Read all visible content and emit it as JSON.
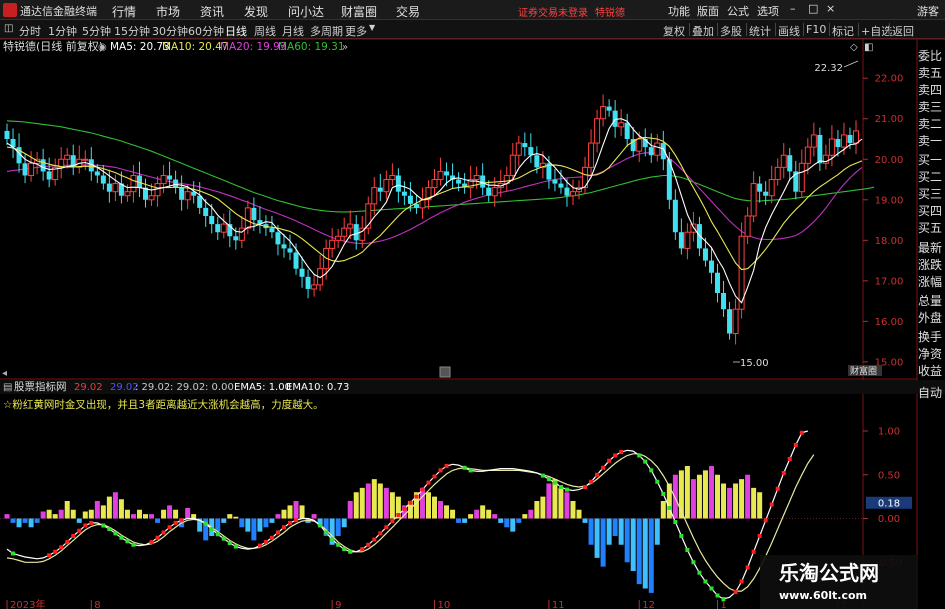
{
  "app": {
    "title": "通达信金融终端",
    "menus": [
      "行情",
      "市场",
      "资讯",
      "发现",
      "问小达",
      "财富圈",
      "交易"
    ],
    "notice": "证券交易未登录",
    "stock_short": "特锐德",
    "right_menus": [
      "功能",
      "版面",
      "公式",
      "选项"
    ],
    "guest": "游客"
  },
  "toolbar": {
    "periods": [
      "分时",
      "1分钟",
      "5分钟",
      "15分钟",
      "30分钟",
      "60分钟",
      "日线",
      "周线",
      "月线",
      "多周期",
      "更多"
    ],
    "active": "日线",
    "right": [
      "复权",
      "叠加",
      "多股",
      "统计",
      "画线",
      "F10",
      "标记",
      "+自选",
      "返回"
    ]
  },
  "main": {
    "title": "特锐德(日线 前复权)",
    "ma": [
      {
        "label": "MA5: 20.73",
        "color": "#ffffff"
      },
      {
        "label": "MA10: 20.47",
        "color": "#e8e850"
      },
      {
        "label": "MA20: 19.93",
        "color": "#e040e0"
      },
      {
        "label": "MA60: 19.31",
        "color": "#30c030"
      }
    ],
    "hi_label": "22.32",
    "lo_label": "15.00",
    "tag": "财富圈"
  },
  "right_panel": [
    "委比",
    "卖五",
    "卖四",
    "卖三",
    "卖二",
    "卖一",
    "买一",
    "买二",
    "买三",
    "买四",
    "买五",
    "最新",
    "涨跌",
    "涨幅",
    "总量",
    "外盘",
    "换手",
    "净资",
    "收益"
  ],
  "sub": {
    "tab": "股票指标网",
    "vals": [
      {
        "label": "29.02",
        "color": "#e04040"
      },
      {
        "label": "29.02",
        "color": "#5050ff"
      },
      {
        "label": ": 29.02",
        "color": "#c8c8c8"
      },
      {
        "label": ": 29.02",
        "color": "#c8c8c8"
      },
      {
        "label": ": 0.00",
        "color": "#c8c8c8"
      },
      {
        "label": "EMA5: 1.00",
        "color": "#ffffff"
      },
      {
        "label": "EMA10: 0.73",
        "color": "#ffffff"
      }
    ],
    "note": "☆粉红黄网时金叉出现，并且3者距离越近大涨机会越高，力度越大。",
    "auto": "自动",
    "cur": "0.18"
  },
  "axis": {
    "dates": [
      "2023年",
      "8",
      "9",
      "10",
      "11",
      "12",
      "1",
      "2"
    ]
  },
  "watermark": {
    "title": "乐淘公式网",
    "url": "www.60lt.com"
  },
  "chart_data": [
    {
      "type": "candlestick",
      "title": "特锐德(日线 前复权)",
      "ylim": [
        14.8,
        22.4
      ],
      "y_ticks": [
        15,
        16,
        17,
        18,
        19,
        20,
        21,
        22
      ],
      "x_ticks": [
        "2023年",
        "8",
        "9",
        "10",
        "11",
        "12",
        "1",
        "2"
      ],
      "close": [
        20.5,
        20.3,
        19.9,
        19.6,
        19.9,
        20,
        19.7,
        19.5,
        19.8,
        20,
        20.1,
        19.8,
        20,
        20,
        19.7,
        19.6,
        19.4,
        19.2,
        19.4,
        19.1,
        19.2,
        19.6,
        19.3,
        19,
        19.1,
        19.4,
        19.6,
        19.5,
        19.3,
        19,
        19.2,
        19.1,
        18.8,
        18.6,
        18.4,
        18.2,
        18.4,
        18.1,
        18,
        18.3,
        18.8,
        18.5,
        18.4,
        18.3,
        18.2,
        17.9,
        17.8,
        17.7,
        17.3,
        17.1,
        16.8,
        16.9,
        17.3,
        17.8,
        18,
        18.1,
        18.3,
        18.4,
        18,
        18.3,
        18.9,
        19.3,
        19.2,
        19.5,
        19.6,
        19.2,
        19.1,
        18.9,
        18.8,
        19,
        19.3,
        19.5,
        19.7,
        19.6,
        19.5,
        19.4,
        19.3,
        19.5,
        19.6,
        19.3,
        19.1,
        19.3,
        19.4,
        19.6,
        20.1,
        20.4,
        20.3,
        20.1,
        19.8,
        19.9,
        19.5,
        19.4,
        19.3,
        19.1,
        19.2,
        19.3,
        19.8,
        20.4,
        21,
        21.3,
        21.2,
        20.8,
        20.9,
        20.5,
        20.2,
        20.5,
        20.3,
        20.1,
        20.4,
        20,
        19,
        18.2,
        17.8,
        18.2,
        18.4,
        17.8,
        17.5,
        17.2,
        16.7,
        16.3,
        15.7,
        16.3,
        18.1,
        18.6,
        19.4,
        19.2,
        19.1,
        19.5,
        19.8,
        20.1,
        19.7,
        19.2,
        19.9,
        20.3,
        20.6,
        19.9,
        20.1,
        20.5,
        20.3,
        20.6,
        20.4,
        20.7
      ],
      "ma5": [
        20.4,
        20.3,
        20.15,
        20,
        19.92,
        19.88,
        19.8,
        19.75,
        19.76,
        19.78,
        19.82,
        19.84,
        19.9,
        19.92,
        19.87,
        19.8,
        19.7,
        19.59,
        19.48,
        19.38,
        19.3,
        19.31,
        19.3,
        19.27,
        19.24,
        19.27,
        19.3,
        19.34,
        19.38,
        19.36,
        19.32,
        19.22,
        19.12,
        18.95,
        18.82,
        18.62,
        18.48,
        18.35,
        18.22,
        18.2,
        18.32,
        18.34,
        18.4,
        18.46,
        18.44,
        18.26,
        18.12,
        17.98,
        17.78,
        17.56,
        17.34,
        17.16,
        17.08,
        17.18,
        17.36,
        17.62,
        17.9,
        18.12,
        18.16,
        18.22,
        18.38,
        18.58,
        18.74,
        18.94,
        19.3,
        19.36,
        19.32,
        19.26,
        19.12,
        19,
        19.02,
        19.1,
        19.24,
        19.42,
        19.52,
        19.54,
        19.5,
        19.46,
        19.46,
        19.42,
        19.36,
        19.36,
        19.34,
        19.4,
        19.5,
        19.78,
        19.96,
        20.1,
        20.14,
        20.1,
        19.94,
        19.8,
        19.62,
        19.44,
        19.3,
        19.26,
        19.32,
        19.56,
        19.94,
        20.36,
        20.76,
        20.98,
        21,
        20.94,
        20.74,
        20.58,
        20.48,
        20.34,
        20.3,
        20.26,
        19.96,
        19.56,
        19.1,
        18.64,
        18.32,
        18.12,
        17.98,
        17.82,
        17.54,
        17.3,
        16.94,
        16.62,
        16.46,
        16.84,
        17.26,
        17.9,
        18.32,
        18.64,
        18.92,
        19.2,
        19.5,
        19.64,
        19.68,
        19.74,
        19.86,
        19.96,
        19.94,
        20.02,
        20.14,
        20.24,
        20.36,
        20.38,
        20.5
      ],
      "ma10": [
        20.3,
        20.28,
        20.22,
        20.14,
        20.05,
        19.96,
        19.92,
        19.88,
        19.84,
        19.82,
        19.81,
        19.81,
        19.82,
        19.83,
        19.82,
        19.81,
        19.77,
        19.72,
        19.67,
        19.6,
        19.54,
        19.47,
        19.43,
        19.38,
        19.33,
        19.29,
        19.3,
        19.3,
        19.31,
        19.3,
        19.29,
        19.26,
        19.22,
        19.16,
        19.1,
        19.02,
        18.9,
        18.78,
        18.66,
        18.56,
        18.48,
        18.41,
        18.38,
        18.34,
        18.32,
        18.3,
        18.26,
        18.22,
        18.14,
        18.04,
        17.92,
        17.8,
        17.68,
        17.56,
        17.5,
        17.48,
        17.5,
        17.56,
        17.62,
        17.71,
        17.86,
        18,
        18.12,
        18.28,
        18.44,
        18.6,
        18.74,
        18.84,
        18.92,
        19,
        19.05,
        19.1,
        19.16,
        19.22,
        19.28,
        19.3,
        19.32,
        19.34,
        19.37,
        19.41,
        19.43,
        19.44,
        19.45,
        19.46,
        19.49,
        19.54,
        19.62,
        19.7,
        19.76,
        19.82,
        19.85,
        19.86,
        19.84,
        19.8,
        19.74,
        19.68,
        19.62,
        19.6,
        19.62,
        19.68,
        19.8,
        19.98,
        20.16,
        20.34,
        20.44,
        20.52,
        20.54,
        20.52,
        20.5,
        20.44,
        20.32,
        20.1,
        19.84,
        19.56,
        19.3,
        19.04,
        18.76,
        18.46,
        18.22,
        17.96,
        17.7,
        17.44,
        17.28,
        17.3,
        17.44,
        17.6,
        17.78,
        17.98,
        18.2,
        18.42,
        18.6,
        18.76,
        18.9,
        19.06,
        19.2,
        19.32,
        19.42,
        19.52,
        19.62,
        19.74,
        19.84,
        19.9,
        19.96
      ],
      "ma20": [
        19.7,
        19.72,
        19.74,
        19.76,
        19.78,
        19.8,
        19.82,
        19.83,
        19.84,
        19.85,
        19.85,
        19.86,
        19.86,
        19.86,
        19.86,
        19.85,
        19.84,
        19.82,
        19.8,
        19.76,
        19.72,
        19.68,
        19.64,
        19.6,
        19.56,
        19.52,
        19.48,
        19.45,
        19.42,
        19.4,
        19.38,
        19.35,
        19.32,
        19.28,
        19.24,
        19.2,
        19.15,
        19.1,
        19.05,
        18.99,
        18.94,
        18.88,
        18.82,
        18.76,
        18.71,
        18.66,
        18.6,
        18.54,
        18.48,
        18.41,
        18.34,
        18.27,
        18.2,
        18.13,
        18.07,
        18.02,
        17.98,
        17.95,
        17.93,
        17.92,
        17.93,
        17.95,
        17.98,
        18.02,
        18.07,
        18.13,
        18.2,
        18.27,
        18.35,
        18.43,
        18.52,
        18.6,
        18.68,
        18.75,
        18.82,
        18.88,
        18.94,
        18.99,
        19.04,
        19.08,
        19.12,
        19.15,
        19.18,
        19.21,
        19.24,
        19.28,
        19.32,
        19.36,
        19.4,
        19.44,
        19.47,
        19.5,
        19.52,
        19.54,
        19.55,
        19.56,
        19.57,
        19.6,
        19.64,
        19.7,
        19.78,
        19.86,
        19.94,
        20.02,
        20.08,
        20.13,
        20.16,
        20.16,
        20.14,
        20.1,
        20.02,
        19.9,
        19.76,
        19.6,
        19.44,
        19.28,
        19.12,
        18.96,
        18.8,
        18.64,
        18.48,
        18.34,
        18.22,
        18.13,
        18.07,
        18.03,
        18.02,
        18.02,
        18.03,
        18.05,
        18.08,
        18.12,
        18.2,
        18.32,
        18.46,
        18.62,
        18.8,
        19,
        19.2,
        19.38,
        19.54,
        19.68,
        19.8
      ],
      "ma60": [
        20.95,
        20.94,
        20.93,
        20.92,
        20.9,
        20.88,
        20.86,
        20.84,
        20.82,
        20.8,
        20.77,
        20.74,
        20.71,
        20.68,
        20.65,
        20.61,
        20.57,
        20.53,
        20.49,
        20.45,
        20.4,
        20.35,
        20.3,
        20.25,
        20.2,
        20.14,
        20.08,
        20.02,
        19.96,
        19.9,
        19.84,
        19.78,
        19.72,
        19.66,
        19.6,
        19.54,
        19.48,
        19.42,
        19.36,
        19.3,
        19.24,
        19.18,
        19.13,
        19.08,
        19.03,
        18.98,
        18.94,
        18.9,
        18.86,
        18.82,
        18.79,
        18.76,
        18.74,
        18.72,
        18.71,
        18.7,
        18.7,
        18.7,
        18.71,
        18.72,
        18.73,
        18.74,
        18.75,
        18.76,
        18.77,
        18.78,
        18.79,
        18.8,
        18.81,
        18.82,
        18.83,
        18.84,
        18.85,
        18.86,
        18.87,
        18.88,
        18.89,
        18.9,
        18.91,
        18.92,
        18.93,
        18.94,
        18.95,
        18.96,
        18.97,
        18.98,
        18.99,
        19,
        19.01,
        19.02,
        19.03,
        19.04,
        19.06,
        19.08,
        19.1,
        19.12,
        19.15,
        19.18,
        19.22,
        19.26,
        19.3,
        19.34,
        19.38,
        19.42,
        19.46,
        19.5,
        19.53,
        19.56,
        19.58,
        19.6,
        19.6,
        19.58,
        19.55,
        19.5,
        19.44,
        19.38,
        19.32,
        19.26,
        19.2,
        19.14,
        19.08,
        19.03,
        19,
        18.98,
        18.97,
        18.97,
        18.98,
        18.99,
        19,
        19.01,
        19.02,
        19.04,
        19.06,
        19.08,
        19.1,
        19.12,
        19.14,
        19.16,
        19.18,
        19.2,
        19.22,
        19.24,
        19.26,
        19.28,
        19.31
      ]
    },
    {
      "type": "bar",
      "title": "股票指标网",
      "ylim": [
        -1.0,
        1.4
      ],
      "y_ticks": [
        1.0,
        0.5,
        0,
        -0.5
      ],
      "current": 0.18,
      "values": [
        0.05,
        -0.05,
        -0.1,
        -0.05,
        -0.1,
        -0.05,
        0.08,
        0.1,
        0.05,
        0.1,
        0.2,
        0.1,
        -0.05,
        0.08,
        0.1,
        0.2,
        0.15,
        0.25,
        0.3,
        0.22,
        0.1,
        0.05,
        0.1,
        0.05,
        0.05,
        -0.05,
        0.1,
        0.15,
        0.1,
        -0.1,
        0.12,
        0.05,
        -0.15,
        -0.25,
        -0.2,
        -0.15,
        -0.05,
        0.05,
        0.02,
        -0.1,
        -0.15,
        -0.25,
        -0.15,
        -0.1,
        -0.05,
        0.05,
        0.1,
        0.15,
        0.2,
        0.15,
        -0.05,
        0.05,
        -0.08,
        -0.2,
        -0.3,
        -0.2,
        -0.1,
        0.2,
        0.3,
        0.35,
        0.4,
        0.45,
        0.4,
        0.35,
        0.3,
        0.25,
        0.15,
        0.2,
        0.3,
        0.35,
        0.3,
        0.25,
        0.2,
        0.15,
        0.1,
        -0.05,
        -0.05,
        0.05,
        0.1,
        0.15,
        0.1,
        0.05,
        -0.05,
        -0.1,
        -0.15,
        -0.05,
        0.05,
        0.1,
        0.2,
        0.25,
        0.4,
        0.45,
        0.35,
        0.3,
        0.2,
        0.1,
        -0.05,
        -0.3,
        -0.45,
        -0.55,
        -0.3,
        -0.2,
        -0.3,
        -0.5,
        -0.6,
        -0.75,
        -0.8,
        -0.85,
        -0.3,
        0.2,
        0.4,
        0.5,
        0.55,
        0.6,
        0.45,
        0.5,
        0.55,
        0.6,
        0.5,
        0.4,
        0.35,
        0.4,
        0.45,
        0.5,
        0.35,
        0.3
      ],
      "ema5": [
        -0.35,
        -0.4,
        -0.42,
        -0.44,
        -0.45,
        -0.46,
        -0.45,
        -0.42,
        -0.38,
        -0.33,
        -0.27,
        -0.2,
        -0.14,
        -0.08,
        -0.05,
        -0.05,
        -0.08,
        -0.12,
        -0.17,
        -0.22,
        -0.26,
        -0.3,
        -0.31,
        -0.3,
        -0.27,
        -0.22,
        -0.16,
        -0.1,
        -0.05,
        -0.02,
        0.0,
        0.0,
        -0.02,
        -0.06,
        -0.12,
        -0.18,
        -0.23,
        -0.28,
        -0.32,
        -0.34,
        -0.35,
        -0.34,
        -0.31,
        -0.27,
        -0.22,
        -0.16,
        -0.1,
        -0.05,
        -0.02,
        0.0,
        0.0,
        -0.02,
        -0.08,
        -0.16,
        -0.24,
        -0.3,
        -0.35,
        -0.38,
        -0.38,
        -0.35,
        -0.3,
        -0.24,
        -0.17,
        -0.1,
        -0.03,
        0.04,
        0.11,
        0.18,
        0.25,
        0.33,
        0.41,
        0.48,
        0.55,
        0.6,
        0.62,
        0.61,
        0.58,
        0.55,
        0.54,
        0.54,
        0.55,
        0.56,
        0.57,
        0.57,
        0.57,
        0.56,
        0.55,
        0.54,
        0.52,
        0.49,
        0.45,
        0.41,
        0.36,
        0.33,
        0.32,
        0.33,
        0.36,
        0.42,
        0.5,
        0.58,
        0.66,
        0.72,
        0.76,
        0.78,
        0.77,
        0.72,
        0.65,
        0.55,
        0.42,
        0.28,
        0.12,
        -0.04,
        -0.2,
        -0.36,
        -0.5,
        -0.62,
        -0.72,
        -0.8,
        -0.88,
        -0.92,
        -0.9,
        -0.84,
        -0.72,
        -0.56,
        -0.38,
        -0.2,
        -0.02,
        0.16,
        0.34,
        0.52,
        0.68,
        0.84,
        0.98,
        1.0
      ],
      "ema10": [
        -0.45,
        -0.46,
        -0.48,
        -0.5,
        -0.5,
        -0.5,
        -0.49,
        -0.46,
        -0.42,
        -0.37,
        -0.31,
        -0.25,
        -0.19,
        -0.13,
        -0.09,
        -0.07,
        -0.07,
        -0.1,
        -0.14,
        -0.19,
        -0.23,
        -0.27,
        -0.29,
        -0.3,
        -0.29,
        -0.26,
        -0.21,
        -0.15,
        -0.1,
        -0.05,
        -0.02,
        -0.01,
        -0.02,
        -0.05,
        -0.1,
        -0.15,
        -0.2,
        -0.25,
        -0.29,
        -0.32,
        -0.34,
        -0.34,
        -0.33,
        -0.3,
        -0.26,
        -0.21,
        -0.16,
        -0.1,
        -0.06,
        -0.03,
        -0.02,
        -0.03,
        -0.07,
        -0.13,
        -0.2,
        -0.27,
        -0.32,
        -0.36,
        -0.38,
        -0.38,
        -0.35,
        -0.3,
        -0.24,
        -0.17,
        -0.1,
        -0.03,
        0.04,
        0.11,
        0.18,
        0.25,
        0.32,
        0.39,
        0.45,
        0.51,
        0.55,
        0.57,
        0.58,
        0.57,
        0.56,
        0.55,
        0.55,
        0.55,
        0.55,
        0.55,
        0.55,
        0.55,
        0.54,
        0.53,
        0.52,
        0.5,
        0.48,
        0.45,
        0.42,
        0.39,
        0.37,
        0.36,
        0.37,
        0.4,
        0.45,
        0.51,
        0.57,
        0.63,
        0.68,
        0.72,
        0.74,
        0.74,
        0.71,
        0.66,
        0.59,
        0.49,
        0.37,
        0.23,
        0.08,
        -0.07,
        -0.22,
        -0.36,
        -0.48,
        -0.58,
        -0.67,
        -0.74,
        -0.8,
        -0.83,
        -0.83,
        -0.78,
        -0.69,
        -0.57,
        -0.43,
        -0.28,
        -0.12,
        0.04,
        0.2,
        0.36,
        0.5,
        0.63,
        0.73
      ]
    }
  ]
}
